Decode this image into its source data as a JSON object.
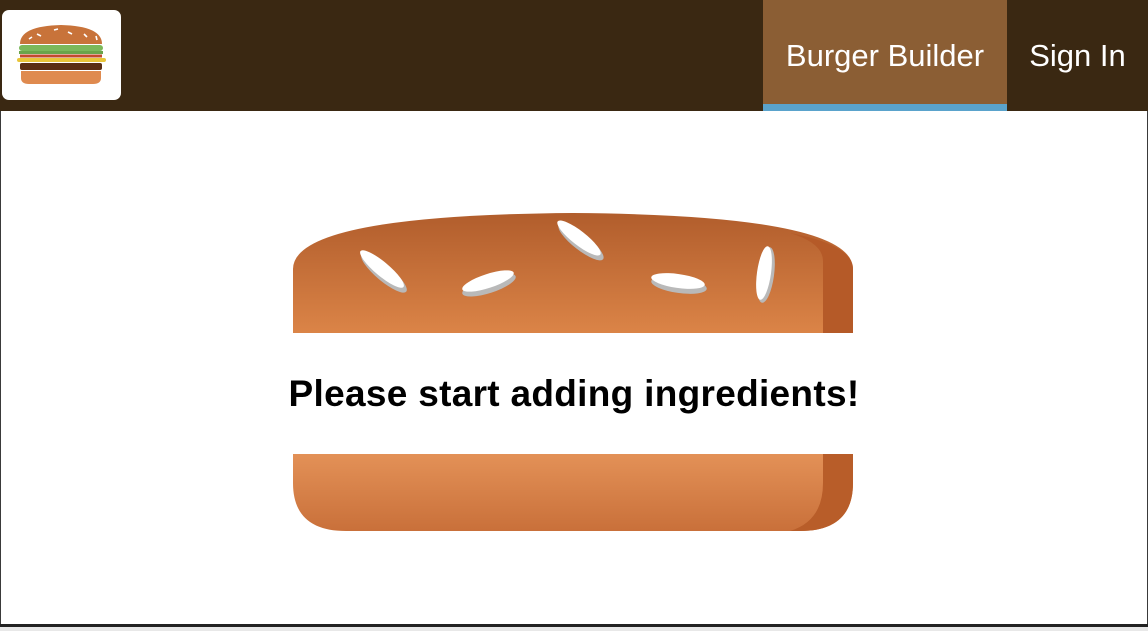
{
  "toolbar": {
    "background": "#3a2812",
    "logo_icon": "burger-logo-icon",
    "nav": {
      "burger_builder": "Burger Builder",
      "sign_in": "Sign In"
    },
    "active_color": "#8b5e34",
    "active_underline": "#5aa3cc"
  },
  "main": {
    "message": "Please start adding ingredients!",
    "bread_top_icon": "bread-top-icon",
    "bread_bottom_icon": "bread-bottom-icon"
  }
}
